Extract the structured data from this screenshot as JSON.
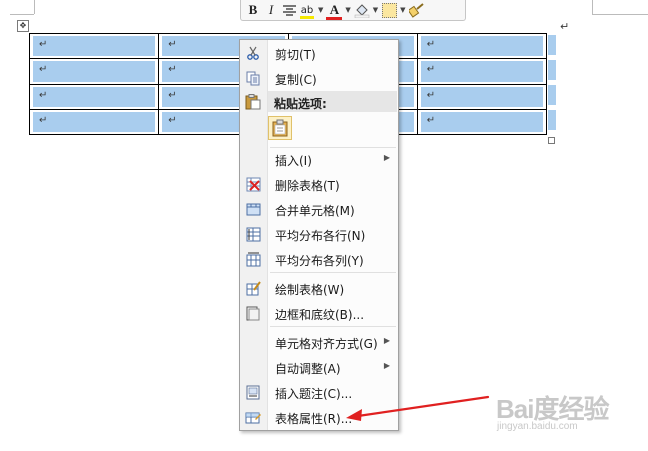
{
  "toolbar": {
    "bold": "B",
    "italic": "I",
    "highlight": "ab",
    "font_color": "A"
  },
  "document": {
    "paragraph_mark": "↵",
    "cell_mark": "↵",
    "rows": 4,
    "cols": 4
  },
  "context_menu": {
    "items": [
      {
        "label": "剪切(T)",
        "icon": "scissors-icon"
      },
      {
        "label": "复制(C)",
        "icon": "copy-icon"
      },
      {
        "label": "粘贴选项:",
        "icon": "paste-icon"
      },
      {
        "label": "插入(I)",
        "has_submenu": true
      },
      {
        "label": "删除表格(T)",
        "icon": "delete-table-icon"
      },
      {
        "label": "合并单元格(M)",
        "icon": "merge-cells-icon"
      },
      {
        "label": "平均分布各行(N)",
        "icon": "distribute-rows-icon"
      },
      {
        "label": "平均分布各列(Y)",
        "icon": "distribute-columns-icon"
      },
      {
        "label": "绘制表格(W)",
        "icon": "draw-table-icon"
      },
      {
        "label": "边框和底纹(B)...",
        "icon": "borders-shading-icon"
      },
      {
        "label": "单元格对齐方式(G)",
        "has_submenu": true
      },
      {
        "label": "自动调整(A)",
        "has_submenu": true
      },
      {
        "label": "插入题注(C)...",
        "icon": "caption-icon"
      },
      {
        "label": "表格属性(R)...",
        "icon": "table-properties-icon"
      }
    ]
  },
  "watermark": {
    "brand": "Bai度经验",
    "url": "jingyan.baidu.com"
  },
  "colors": {
    "selection": "#a9cdee",
    "arrow": "#e02020"
  }
}
